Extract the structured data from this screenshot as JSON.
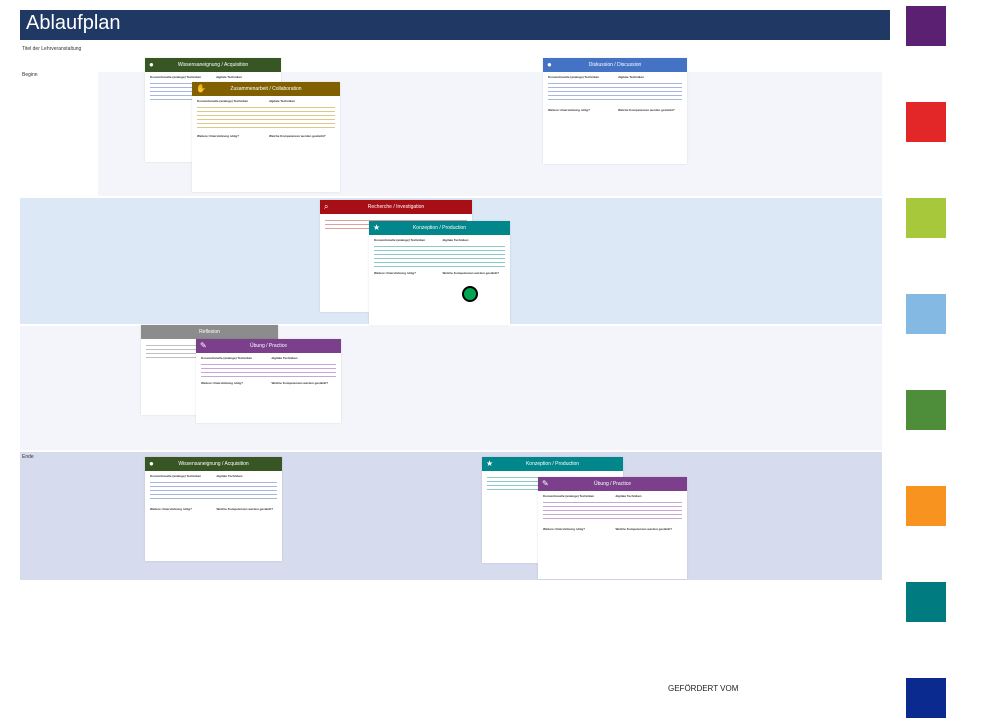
{
  "title": "Ablaufplan",
  "subtitle": "Titel der Lehrveranstaltung",
  "lanes": {
    "begin": "Beginn",
    "end": "Ende"
  },
  "cards": {
    "acq1": "Wissensaneignung / Acquisition",
    "collab": "Zusammenarbeit / Collaboration",
    "disc": "Diskussion / Discussion",
    "inv": "Recherche / Investigation",
    "prod1": "Konzeption / Production",
    "refl": "Reflexion",
    "prac1": "Übung / Practice",
    "acq2": "Wissensaneignung / Acquisition",
    "prod2": "Konzeption / Production",
    "prac2": "Übung / Practice"
  },
  "card_columns": {
    "analog": "Konventionelle (analoge) Techniken",
    "digital": "digitale Techniken",
    "support": "Weitere Unterstützung nötig?",
    "competence": "Welche Kompetenzen werden gestärkt?"
  },
  "colors": {
    "header": "#1f3864",
    "acquisition": "#375623",
    "collaboration": "#806000",
    "discussion": "#4472c4",
    "investigation": "#a50f15",
    "production": "#00868b",
    "reflection": "#8c8c8c",
    "practice": "#7b3f8c"
  },
  "swatches": [
    "#5b2072",
    "#e32729",
    "#a6c83a",
    "#84b9e3",
    "#4e8d3a",
    "#f7931e",
    "#007b7f",
    "#0a2a8f"
  ],
  "footer": "GEFÖRDERT VOM"
}
